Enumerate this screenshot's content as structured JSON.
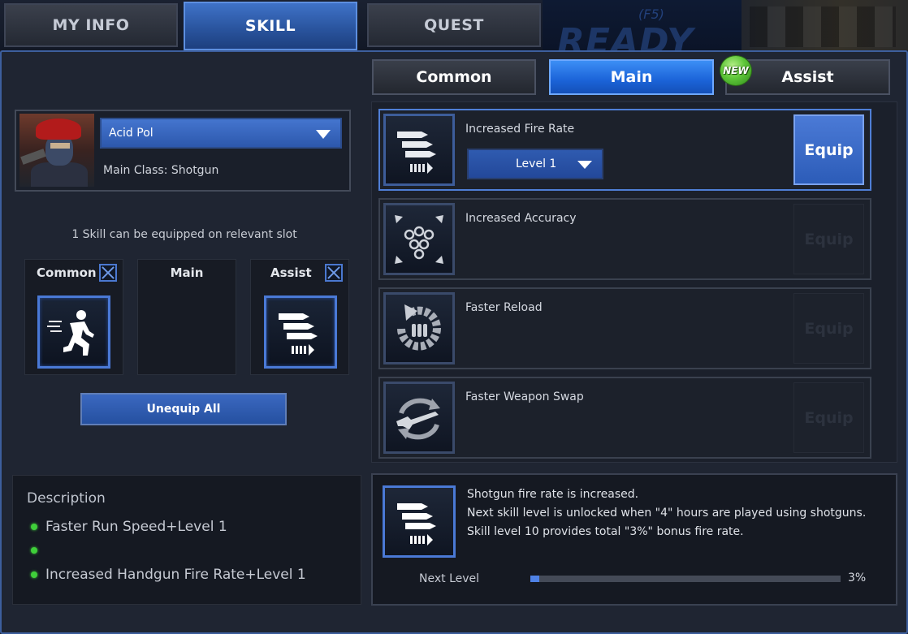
{
  "top_tabs": [
    {
      "label": "MY INFO",
      "active": false
    },
    {
      "label": "SKILL",
      "active": true
    },
    {
      "label": "QUEST",
      "active": false
    }
  ],
  "background_hud": {
    "ready_text": "READY",
    "hotkey_text": "(F5)"
  },
  "sub_tabs": [
    {
      "label": "Common",
      "active": false
    },
    {
      "label": "Main",
      "active": true
    },
    {
      "label": "Assist",
      "active": false,
      "badge": "NEW"
    }
  ],
  "character": {
    "name": "Acid Pol",
    "main_class": "Main Class: Shotgun",
    "portrait_icon": "soldier-portrait"
  },
  "equip_hint": "1 Skill can be equipped on relevant slot",
  "slots": [
    {
      "title": "Common",
      "has_remove": true,
      "icon": "running-man-icon"
    },
    {
      "title": "Main",
      "has_remove": false,
      "icon": null
    },
    {
      "title": "Assist",
      "has_remove": true,
      "icon": "bullets-icon"
    }
  ],
  "unequip_all_label": "Unequip All",
  "description": {
    "title": "Description",
    "items": [
      "Faster Run Speed+Level 1",
      "",
      "Increased Handgun Fire Rate+Level 1"
    ]
  },
  "skills": [
    {
      "name": "Increased Fire Rate",
      "icon": "bullets-icon",
      "level": "Level 1",
      "equip_label": "Equip",
      "equip_enabled": true,
      "selected": true
    },
    {
      "name": "Increased Accuracy",
      "icon": "accuracy-dots-icon",
      "equip_label": "Equip",
      "equip_enabled": false,
      "selected": false
    },
    {
      "name": "Faster Reload",
      "icon": "reload-icon",
      "equip_label": "Equip",
      "equip_enabled": false,
      "selected": false
    },
    {
      "name": "Faster Weapon Swap",
      "icon": "weapon-swap-icon",
      "equip_label": "Equip",
      "equip_enabled": false,
      "selected": false
    }
  ],
  "info": {
    "icon": "bullets-icon",
    "lines": [
      "Shotgun fire rate is increased.",
      "Next skill level is unlocked when \"4\" hours are played using shotguns.",
      "Skill level 10 provides total \"3%\" bonus fire rate."
    ],
    "next_level_label": "Next Level",
    "progress_percent": 3,
    "progress_text": "3%"
  },
  "colors": {
    "accent_blue": "#2c63d8",
    "active_tab": "#3f72c8",
    "bullet_green": "#3fcf3a",
    "new_badge": "#5fc73a"
  }
}
